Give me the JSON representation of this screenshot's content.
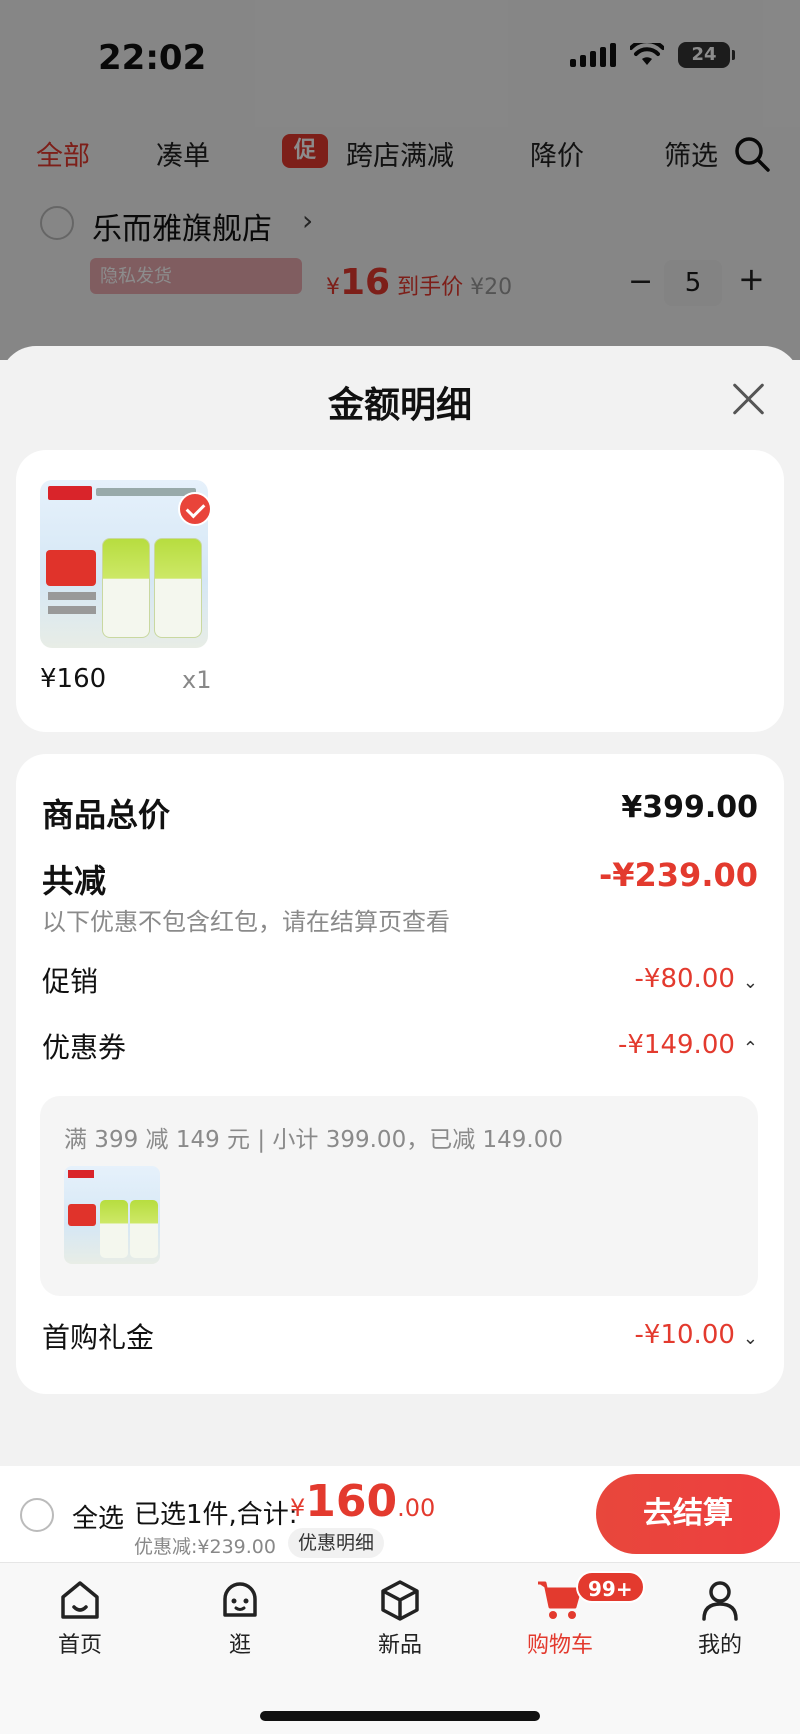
{
  "status_bar": {
    "time": "22:02",
    "battery": "24"
  },
  "filter_tabs": {
    "all": "全部",
    "bundle": "凑单",
    "promo_chip": "促",
    "cross_store": "跨店满减",
    "price_drop": "降价",
    "filter": "筛选"
  },
  "store": {
    "name": "乐而雅旗舰店",
    "chevron": "›"
  },
  "background_product": {
    "tag": "隐私发货",
    "price_symbol": "¥",
    "price": "16",
    "price_suffix": "到手价",
    "original_price": "¥20",
    "quantity": "5",
    "minus": "−",
    "plus": "+"
  },
  "sheet": {
    "title": "金额明细",
    "item": {
      "price": "¥160",
      "quantity": "x1"
    },
    "summary": {
      "total_label": "商品总价",
      "total_value": "¥399.00",
      "reduce_label": "共减",
      "reduce_value": "-¥239.00",
      "hint": "以下优惠不包含红包，请在结算页查看",
      "promo_label": "促销",
      "promo_value": "-¥80.00",
      "coupon_label": "优惠券",
      "coupon_value": "-¥149.00",
      "coupon_desc": "满 399 减 149 元 | 小计 399.00，已减 149.00",
      "gift_label": "首购礼金",
      "gift_value": "-¥10.00"
    }
  },
  "checkout": {
    "select_all": "全选",
    "selected_info": "已选1件,合计:",
    "currency": "¥",
    "total_int": "160",
    "total_dec": ".00",
    "discount": "优惠减:¥239.00",
    "detail": "优惠明细",
    "button": "去结算"
  },
  "tab_bar": {
    "home": "首页",
    "browse": "逛",
    "new": "新品",
    "cart": "购物车",
    "cart_badge": "99+",
    "mine": "我的"
  },
  "colors": {
    "accent": "#e33a2e",
    "sheet_bg": "#f2f2f2"
  }
}
